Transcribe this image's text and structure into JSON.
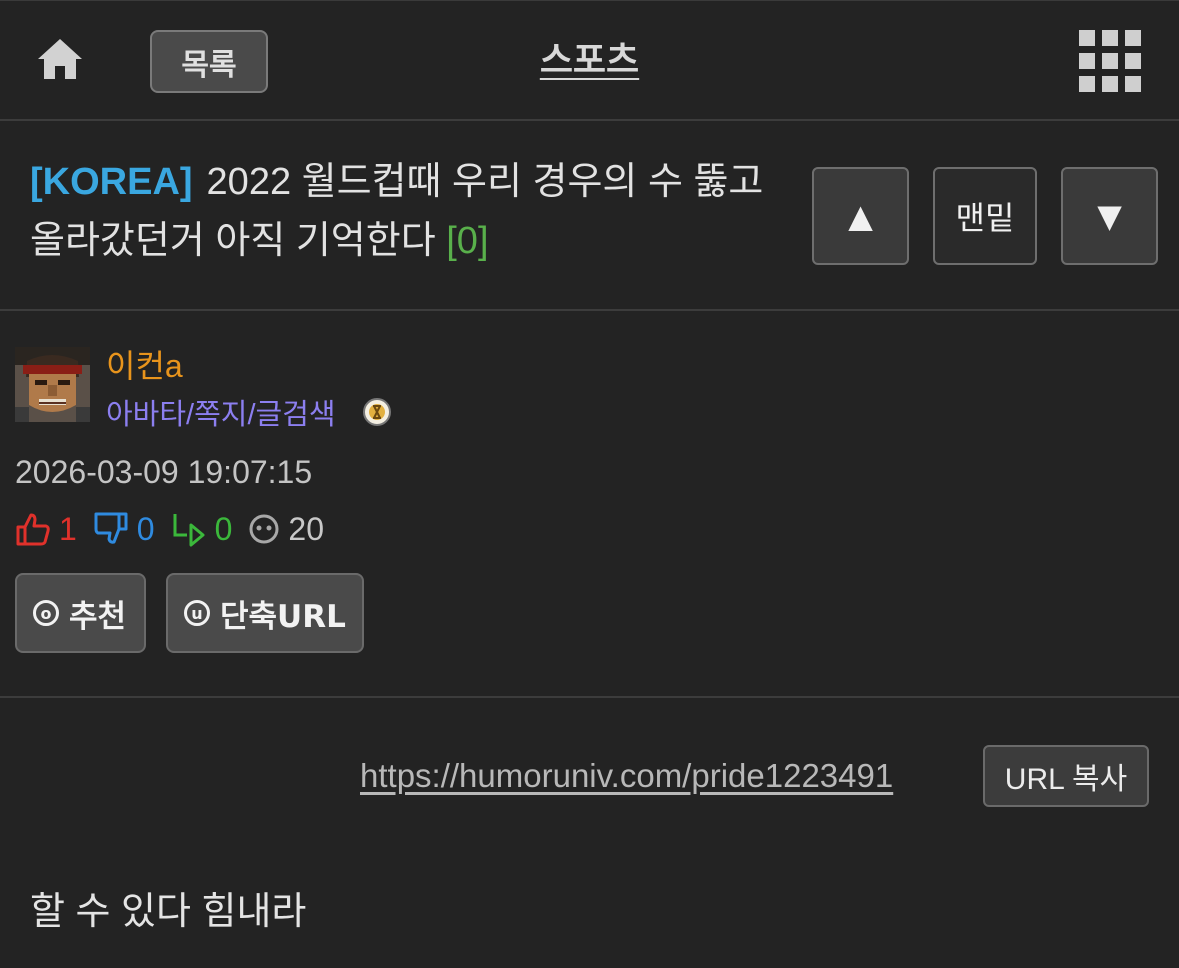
{
  "header": {
    "home_icon": "home-icon",
    "list_label": "목록",
    "board_title": "스포츠",
    "menu_icon": "grid-icon"
  },
  "post": {
    "category": "[KOREA]",
    "title": "2022 월드컵때 우리 경우의 수 뚫고 올라갔던거 아직 기억한다",
    "comment_count": "[0]",
    "nav": {
      "up": "▲",
      "bottom": "맨밑",
      "down": "▼"
    }
  },
  "author": {
    "name": "이컨a",
    "links": "아바타/쪽지/글검색",
    "badge_icon": "medal-icon"
  },
  "meta": {
    "date": "2026-03-09 19:07:15",
    "likes": "1",
    "dislikes": "0",
    "shares": "0",
    "views": "20"
  },
  "actions": {
    "recommend_icon_letter": "o",
    "recommend": "추천",
    "shorturl_icon_letter": "u",
    "shorturl": "단축URL"
  },
  "url": {
    "link": "https://humoruniv.com/pride1223491",
    "copy": "URL 복사"
  },
  "body": {
    "text": "할 수 있다 힘내라"
  },
  "colors": {
    "category": "#3aa7e0",
    "comment_count": "#59b04b",
    "author": "#e8941c",
    "links": "#8c7ff0",
    "like": "#e0312b",
    "dislike": "#2f8be0",
    "share": "#3bb83b"
  }
}
